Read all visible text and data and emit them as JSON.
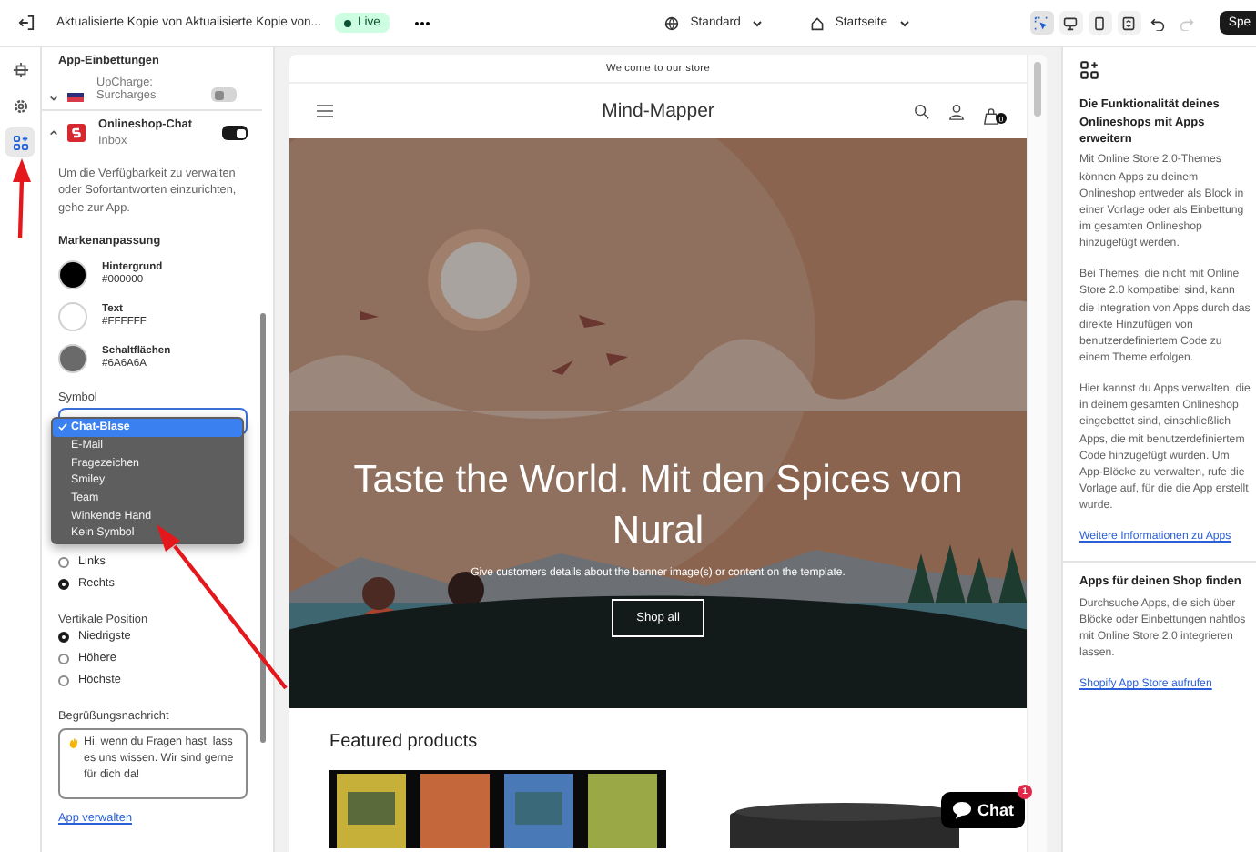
{
  "topbar": {
    "title": "Aktualisierte Kopie von Aktualisierte Kopie von...",
    "status": "Live",
    "theme": "Standard",
    "page": "Startseite",
    "tools": [
      {
        "kind": "inspect",
        "selected": true
      },
      {
        "kind": "desktop",
        "selected": false
      },
      {
        "kind": "mobile",
        "selected": false
      },
      {
        "kind": "fullscreen",
        "selected": false
      }
    ],
    "redo_disabled": true,
    "save_label": "Spe"
  },
  "rail": [
    {
      "kind": "sections",
      "selected": false
    },
    {
      "kind": "settings",
      "selected": false
    },
    {
      "kind": "apps",
      "selected": true
    }
  ],
  "panel": {
    "title": "App-Einbettungen",
    "apps": [
      {
        "name": "UpCharge: Surcharges",
        "expanded": false,
        "enabled": false
      },
      {
        "name": "Onlineshop-Chat",
        "subtitle": "Inbox",
        "expanded": true,
        "enabled": true
      }
    ],
    "description": "Um die Verfügbarkeit zu verwalten oder Sofortantworten einzurichten, gehe zur App.",
    "brand_heading": "Markenanpassung",
    "colors": [
      {
        "label": "Hintergrund",
        "value": "#000000",
        "color": "#000000"
      },
      {
        "label": "Text",
        "value": "#FFFFFF",
        "color": "#ffffff"
      },
      {
        "label": "Schaltflächen",
        "value": "#6A6A6A",
        "color": "#6a6a6a"
      }
    ],
    "symbol": {
      "label": "Symbol",
      "open": true,
      "options": [
        {
          "label": "Chat-Blase",
          "selected": true
        },
        {
          "label": "E-Mail",
          "selected": false
        },
        {
          "label": "Fragezeichen",
          "selected": false
        },
        {
          "label": "Smiley",
          "selected": false
        },
        {
          "label": "Team",
          "selected": false
        },
        {
          "label": "Winkende Hand",
          "selected": false
        },
        {
          "label": "Kein Symbol",
          "selected": false
        }
      ]
    },
    "horizontal_options": [
      {
        "label": "Links",
        "selected": false
      },
      {
        "label": "Rechts",
        "selected": true
      }
    ],
    "vertical": {
      "label": "Vertikale Position",
      "options": [
        {
          "label": "Niedrigste",
          "selected": true
        },
        {
          "label": "Höhere",
          "selected": false
        },
        {
          "label": "Höchste",
          "selected": false
        }
      ]
    },
    "greeting": {
      "label": "Begrüßungsnachricht",
      "value": "Hi, wenn du Fragen hast, lass es uns wissen. Wir sind gerne für dich da!"
    },
    "manage_link": "App verwalten"
  },
  "preview": {
    "announcement": "Welcome to our store",
    "brand": "Mind-Mapper",
    "cart_count": "0",
    "hero": {
      "kind": "picture",
      "heading": "Taste the World. Mit den Spices von Nural",
      "text": "Give customers details about the banner image(s) or content on the template.",
      "button": "Shop all"
    },
    "featured_heading": "Featured products",
    "chat": {
      "label": "Chat",
      "badge": "1"
    }
  },
  "info": {
    "heading": "Die Funktionalität deines Onlineshops mit Apps erweitern",
    "paragraphs": [
      "Mit Online Store 2.0-Themes können Apps zu deinem Onlineshop entweder als Block in einer Vorlage oder als Einbettung im gesamten Onlineshop hinzugefügt werden.",
      "Bei Themes, die nicht mit Online Store 2.0 kompatibel sind, kann die Integration von Apps durch das direkte Hinzufügen von benutzerdefiniertem Code zu einem Theme erfolgen.",
      "Hier kannst du Apps verwalten, die in deinem gesamten Onlineshop eingebettet sind, einschließlich Apps, die mit benutzerdefiniertem Code hinzugefügt wurden. Um App-Blöcke zu verwalten, rufe die Vorlage auf, für die die App erstellt wurde."
    ],
    "link": "Weitere Informationen zu Apps",
    "find_heading": "Apps für deinen Shop finden",
    "find_text": "Durchsuche Apps, die sich über Blöcke oder Einbettungen nahtlos mit Online Store 2.0 integrieren lassen.",
    "find_link": "Shopify App Store aufrufen"
  }
}
